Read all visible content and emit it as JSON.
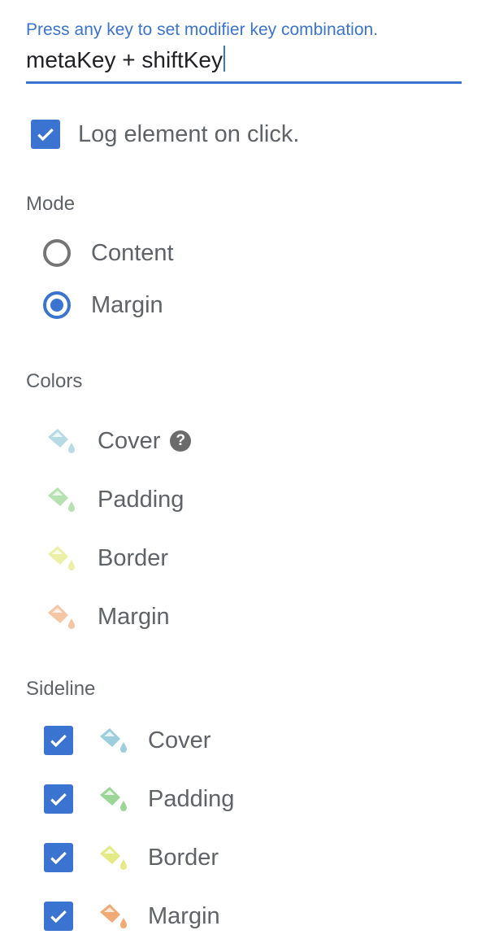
{
  "shortcut": {
    "hint": "Press any key to set modifier key combination.",
    "value": "metaKey + shiftKey"
  },
  "log_click": {
    "label": "Log element on click.",
    "checked": true
  },
  "mode": {
    "title": "Mode",
    "options": [
      {
        "label": "Content",
        "selected": false
      },
      {
        "label": "Margin",
        "selected": true
      }
    ]
  },
  "colors": {
    "title": "Colors",
    "items": [
      {
        "label": "Cover",
        "color": "#b7dbe4",
        "help": "?"
      },
      {
        "label": "Padding",
        "color": "#b6e1b0"
      },
      {
        "label": "Border",
        "color": "#ecf0a6"
      },
      {
        "label": "Margin",
        "color": "#f6c5a3"
      }
    ]
  },
  "sideline": {
    "title": "Sideline",
    "items": [
      {
        "label": "Cover",
        "color": "#9ccedd",
        "checked": true
      },
      {
        "label": "Padding",
        "color": "#9cd697",
        "checked": true
      },
      {
        "label": "Border",
        "color": "#e3ea86",
        "checked": true
      },
      {
        "label": "Margin",
        "color": "#f0aa75",
        "checked": true
      }
    ]
  },
  "theme": {
    "accent": "#3b74d0",
    "text": "#5f6368",
    "help_bg": "#6b6b6b"
  }
}
